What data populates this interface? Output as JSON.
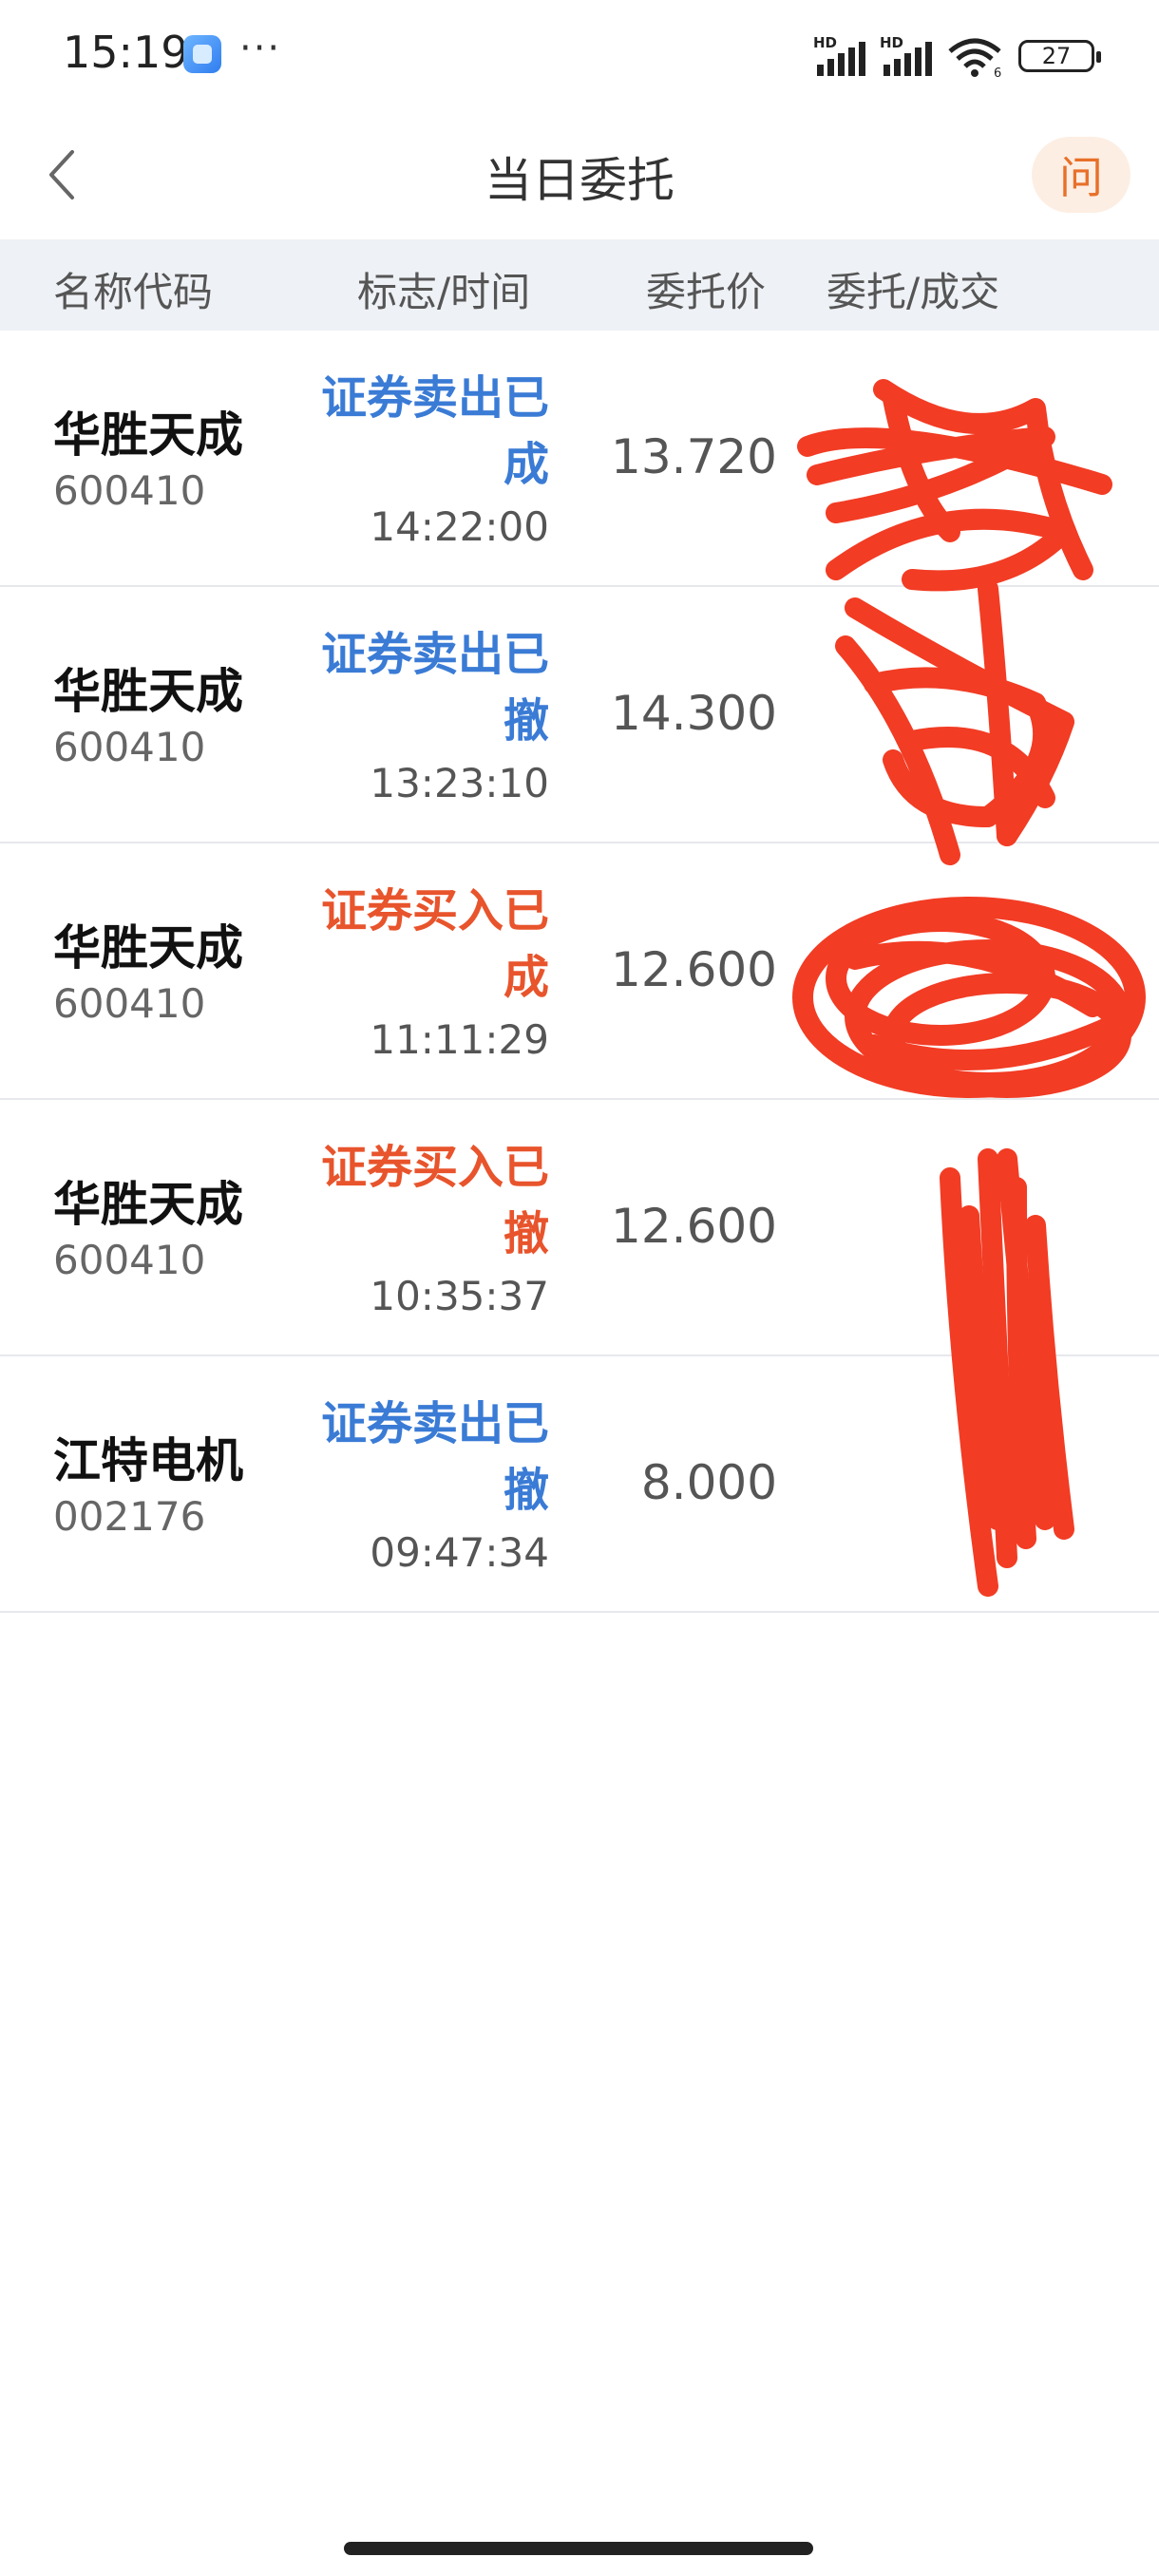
{
  "status_bar": {
    "time": "15:19",
    "more": "···",
    "signal_label_1": "HD",
    "signal_label_2": "HD",
    "wifi_label": "6",
    "battery": "27"
  },
  "header": {
    "title": "当日委托",
    "help_label": "问"
  },
  "table": {
    "columns": [
      "名称代码",
      "标志/时间",
      "委托价",
      "委托/成交"
    ],
    "rows": [
      {
        "name": "华胜天成",
        "code": "600410",
        "flag_line1": "证券卖出已",
        "flag_line2": "成",
        "type": "sell",
        "time": "14:22:00",
        "price": "13.720",
        "qty": "",
        "deal": ""
      },
      {
        "name": "华胜天成",
        "code": "600410",
        "flag_line1": "证券卖出已",
        "flag_line2": "撤",
        "type": "sell",
        "time": "13:23:10",
        "price": "14.300",
        "qty": "",
        "deal": ""
      },
      {
        "name": "华胜天成",
        "code": "600410",
        "flag_line1": "证券买入已",
        "flag_line2": "成",
        "type": "buy",
        "time": "11:11:29",
        "price": "12.600",
        "qty": "",
        "deal": ""
      },
      {
        "name": "华胜天成",
        "code": "600410",
        "flag_line1": "证券买入已",
        "flag_line2": "撤",
        "type": "buy",
        "time": "10:35:37",
        "price": "12.600",
        "qty": "",
        "deal": ""
      },
      {
        "name": "江特电机",
        "code": "002176",
        "flag_line1": "证券卖出已",
        "flag_line2": "撤",
        "type": "sell",
        "time": "09:47:34",
        "price": "8.000",
        "qty": "",
        "deal": ""
      }
    ]
  },
  "colors": {
    "sell": "#3a7bd5",
    "buy": "#e8542c",
    "scribble": "#f23c24",
    "accent": "#e8702a"
  }
}
